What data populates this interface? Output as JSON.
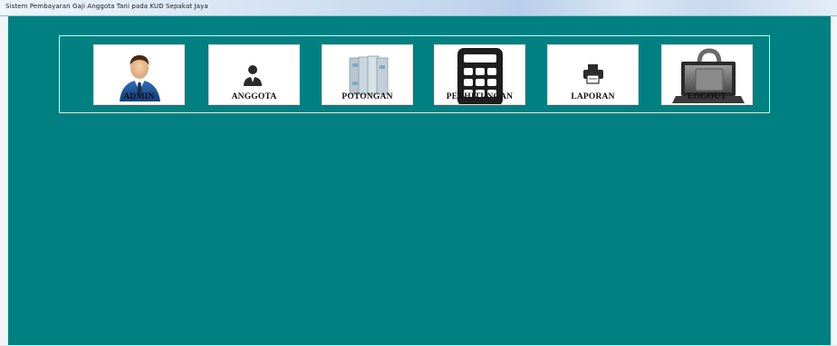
{
  "window": {
    "title": "Sistem Pembayaran Gaji Anggota Tani pada KUD Sepakat Jaya",
    "background_color": "#008080"
  },
  "menu": {
    "buttons": [
      {
        "key": "admin",
        "label": "ADMIN",
        "icon": "admin-user-icon"
      },
      {
        "key": "anggota",
        "label": "ANGGOTA",
        "icon": "member-icon"
      },
      {
        "key": "potongan",
        "label": "POTONGAN",
        "icon": "binders-icon"
      },
      {
        "key": "perhitungan",
        "label": "PERHITUNGAN",
        "icon": "calculator-icon"
      },
      {
        "key": "laporan",
        "label": "LAPORAN",
        "icon": "printer-icon"
      },
      {
        "key": "logout",
        "label": "LOGOUT",
        "icon": "laptop-lock-icon"
      }
    ]
  }
}
